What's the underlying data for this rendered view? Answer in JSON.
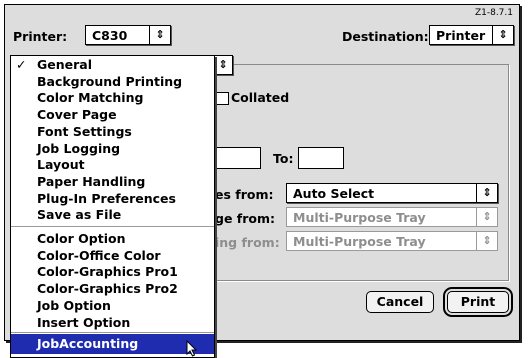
{
  "version": "Z1-8.7.1",
  "printer": {
    "label": "Printer:",
    "value": "C830"
  },
  "destination": {
    "label": "Destination:",
    "value": "Printer"
  },
  "options": {
    "collated": "Collated",
    "to_label": "To:",
    "all_pages_from": {
      "label": "es from:",
      "value": "Auto Select"
    },
    "remaining_from": {
      "label": "ge from:",
      "value": "Multi-Purpose Tray"
    },
    "first_from": {
      "label": "ing from:",
      "value": "Multi-Purpose Tray"
    }
  },
  "buttons": {
    "cancel": "Cancel",
    "print": "Print"
  },
  "menu": {
    "group1": [
      "General",
      "Background Printing",
      "Color Matching",
      "Cover Page",
      "Font Settings",
      "Job Logging",
      "Layout",
      "Paper Handling",
      "Plug-In Preferences",
      "Save as File"
    ],
    "group2": [
      "Color Option",
      "Color-Office Color",
      "Color-Graphics Pro1",
      "Color-Graphics Pro2",
      "Job Option",
      "Insert Option"
    ],
    "selected": "JobAccounting",
    "checked": "General",
    "check_mark": "✓"
  },
  "icons": {
    "popup_arrows": "updown-arrows-icon",
    "cursor": "arrow-cursor-icon"
  },
  "colors": {
    "selection": "#1f2cb0"
  }
}
